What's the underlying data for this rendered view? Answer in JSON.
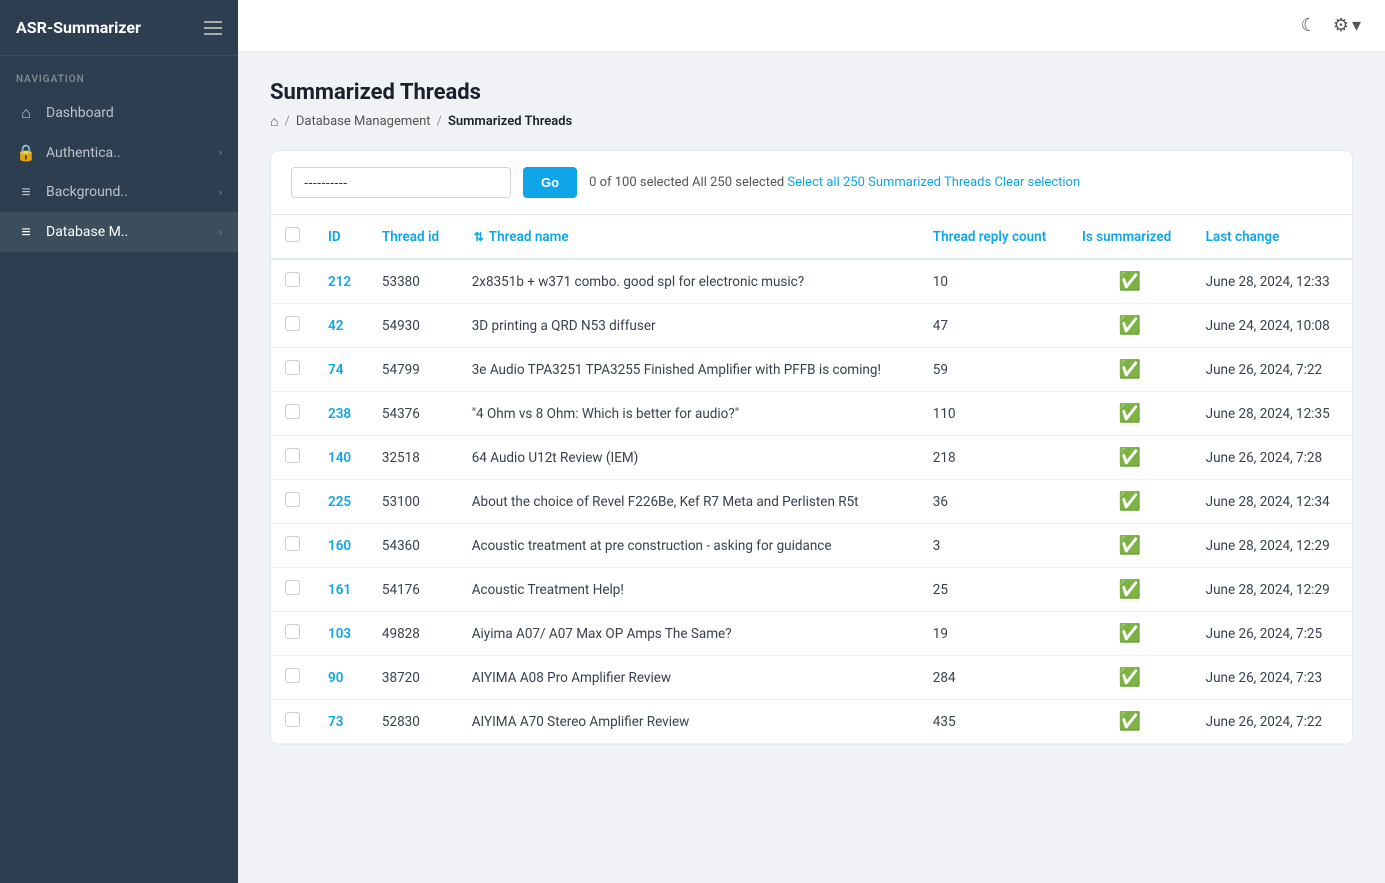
{
  "app": {
    "title": "ASR-Summarizer"
  },
  "sidebar": {
    "nav_label": "NAVIGATION",
    "items": [
      {
        "id": "dashboard",
        "label": "Dashboard",
        "icon": "⌂",
        "arrow": false
      },
      {
        "id": "authentication",
        "label": "Authentica..",
        "icon": "🔒",
        "arrow": true
      },
      {
        "id": "background",
        "label": "Background..",
        "icon": "☰",
        "arrow": true
      },
      {
        "id": "database",
        "label": "Database M..",
        "icon": "☰",
        "arrow": true
      }
    ]
  },
  "topbar": {
    "moon_icon": "☾",
    "settings_icon": "⚙",
    "chevron_icon": "▾"
  },
  "page": {
    "title": "Summarized Threads",
    "breadcrumb": {
      "home_icon": "⌂",
      "separator": "/",
      "parent": "Database Management",
      "current": "Summarized Threads"
    }
  },
  "toolbar": {
    "search_placeholder": "----------",
    "search_value": "----------",
    "go_label": "Go",
    "selection_text": "0 of 100 selected All 250 selected ",
    "select_all_label": "Select all 250 Summarized Threads",
    "clear_label": "Clear selection"
  },
  "table": {
    "columns": [
      {
        "id": "check",
        "label": ""
      },
      {
        "id": "id",
        "label": "ID"
      },
      {
        "id": "thread_id",
        "label": "Thread id"
      },
      {
        "id": "thread_name",
        "label": "Thread name"
      },
      {
        "id": "thread_reply_count",
        "label": "Thread reply count"
      },
      {
        "id": "is_summarized",
        "label": "Is summarized"
      },
      {
        "id": "last_change",
        "label": "Last change"
      }
    ],
    "rows": [
      {
        "id": "212",
        "thread_id": "53380",
        "thread_name": "2x8351b + w371 combo. good spl for electronic music?",
        "reply_count": "10",
        "is_summarized": true,
        "last_change": "June 28, 2024, 12:33"
      },
      {
        "id": "42",
        "thread_id": "54930",
        "thread_name": "3D printing a QRD N53 diffuser",
        "reply_count": "47",
        "is_summarized": true,
        "last_change": "June 24, 2024, 10:08"
      },
      {
        "id": "74",
        "thread_id": "54799",
        "thread_name": "3e Audio TPA3251 TPA3255 Finished Amplifier with PFFB is coming!",
        "reply_count": "59",
        "is_summarized": true,
        "last_change": "June 26, 2024, 7:22"
      },
      {
        "id": "238",
        "thread_id": "54376",
        "thread_name": "\"4 Ohm vs 8 Ohm: Which is better for audio?\"",
        "reply_count": "110",
        "is_summarized": true,
        "last_change": "June 28, 2024, 12:35"
      },
      {
        "id": "140",
        "thread_id": "32518",
        "thread_name": "64 Audio U12t Review (IEM)",
        "reply_count": "218",
        "is_summarized": true,
        "last_change": "June 26, 2024, 7:28"
      },
      {
        "id": "225",
        "thread_id": "53100",
        "thread_name": "About the choice of Revel F226Be, Kef R7 Meta and Perlisten R5t",
        "reply_count": "36",
        "is_summarized": true,
        "last_change": "June 28, 2024, 12:34"
      },
      {
        "id": "160",
        "thread_id": "54360",
        "thread_name": "Acoustic treatment at pre construction - asking for guidance",
        "reply_count": "3",
        "is_summarized": true,
        "last_change": "June 28, 2024, 12:29"
      },
      {
        "id": "161",
        "thread_id": "54176",
        "thread_name": "Acoustic Treatment Help!",
        "reply_count": "25",
        "is_summarized": true,
        "last_change": "June 28, 2024, 12:29"
      },
      {
        "id": "103",
        "thread_id": "49828",
        "thread_name": "Aiyima A07/ A07 Max OP Amps The Same?",
        "reply_count": "19",
        "is_summarized": true,
        "last_change": "June 26, 2024, 7:25"
      },
      {
        "id": "90",
        "thread_id": "38720",
        "thread_name": "AIYIMA A08 Pro Amplifier Review",
        "reply_count": "284",
        "is_summarized": true,
        "last_change": "June 26, 2024, 7:23"
      },
      {
        "id": "73",
        "thread_id": "52830",
        "thread_name": "AIYIMA A70 Stereo Amplifier Review",
        "reply_count": "435",
        "is_summarized": true,
        "last_change": "June 26, 2024, 7:22"
      }
    ]
  }
}
